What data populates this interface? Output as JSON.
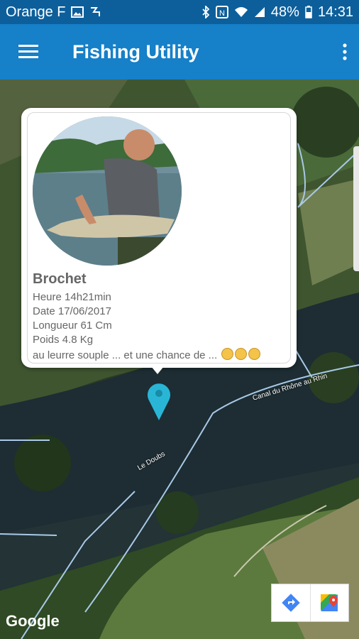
{
  "status_bar": {
    "carrier": "Orange F",
    "battery": "48%",
    "time": "14:31",
    "icons": [
      "image-icon",
      "sync-icon",
      "bluetooth-icon",
      "nfc-icon",
      "wifi-icon",
      "signal-icon",
      "battery-icon"
    ]
  },
  "app_bar": {
    "title": "Fishing Utility",
    "menu_icon": "hamburger-menu-icon",
    "overflow_icon": "more-vert-icon"
  },
  "info_window": {
    "species": "Brochet",
    "lines": [
      "Heure 14h21min",
      "Date 17/06/2017",
      "Longueur 61 Cm",
      "Poids 4.8 Kg",
      "au leurre souple ... et une chance de ..."
    ]
  },
  "map": {
    "labels": [
      "Canal du Rhône au Rhin",
      "Le Doubs"
    ],
    "attribution": "Google",
    "marker_color": "#29b6d6",
    "toolbar": [
      "directions-icon",
      "google-maps-icon"
    ]
  },
  "colors": {
    "status_bar": "#0d5f9b",
    "app_bar": "#1680c8"
  }
}
